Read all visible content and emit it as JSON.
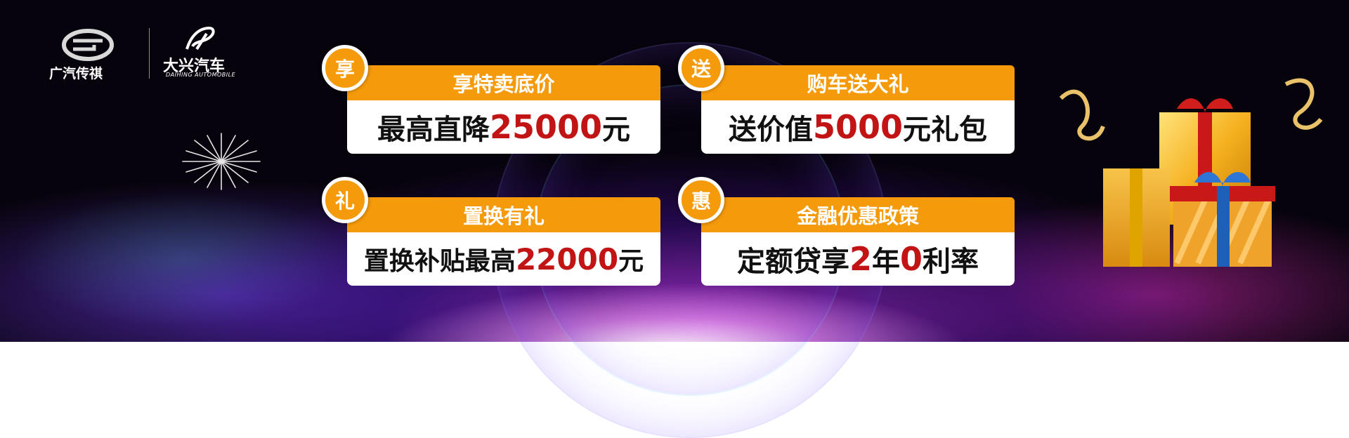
{
  "brand": {
    "gac_name": "广汽传祺",
    "daihing_name": "大兴汽车",
    "daihing_en": "DAIHING AUTOMOBILE"
  },
  "colors": {
    "accent_orange": "#f59a0b",
    "highlight_red": "#c21414",
    "card_bg": "#ffffff"
  },
  "offers": [
    {
      "badge": "享",
      "title": "享特卖底价",
      "pre": "最高直降",
      "num": "25000",
      "post": "元"
    },
    {
      "badge": "送",
      "title": "购车送大礼",
      "pre": "送价值",
      "num": "5000",
      "post": "元礼包"
    },
    {
      "badge": "礼",
      "title": "置换有礼",
      "pre": "置换补贴最高",
      "num": "22000",
      "post": "元"
    },
    {
      "badge": "惠",
      "title": "金融优惠政策",
      "pre": "定额贷享",
      "num": "2",
      "mid": "年",
      "num2": "0",
      "post": "利率"
    }
  ]
}
